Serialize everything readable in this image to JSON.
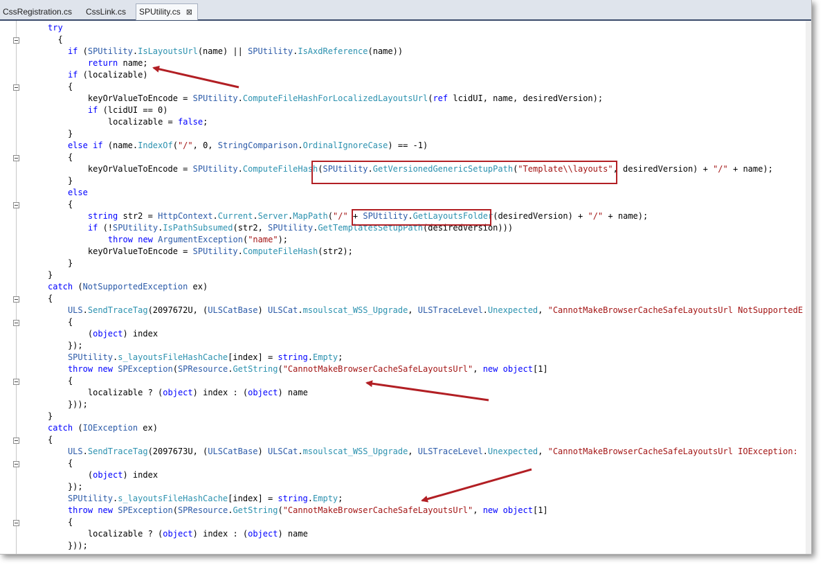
{
  "tabs": [
    {
      "label": "CssRegistration.cs",
      "active": false
    },
    {
      "label": "CssLink.cs",
      "active": false
    },
    {
      "label": "SPUtility.cs",
      "active": true,
      "close": "⊠"
    }
  ],
  "code_lines": [
    [
      {
        "t": "try",
        "c": "kw"
      }
    ],
    [
      {
        "t": "{"
      }
    ],
    [
      {
        "t": "  "
      },
      {
        "t": "if",
        "c": "kw"
      },
      {
        "t": " ("
      },
      {
        "t": "SPUtility",
        "c": "ty"
      },
      {
        "t": "."
      },
      {
        "t": "IsLayoutsUrl",
        "c": "mt"
      },
      {
        "t": "(name) || "
      },
      {
        "t": "SPUtility",
        "c": "ty"
      },
      {
        "t": "."
      },
      {
        "t": "IsAxdReference",
        "c": "mt"
      },
      {
        "t": "(name))"
      }
    ],
    [
      {
        "t": "    "
      },
      {
        "t": "return",
        "c": "kw"
      },
      {
        "t": " name;"
      }
    ],
    [
      {
        "t": "  "
      },
      {
        "t": "if",
        "c": "kw"
      },
      {
        "t": " (localizable)"
      }
    ],
    [
      {
        "t": "  {"
      }
    ],
    [
      {
        "t": "    keyOrValueToEncode = "
      },
      {
        "t": "SPUtility",
        "c": "ty"
      },
      {
        "t": "."
      },
      {
        "t": "ComputeFileHashForLocalizedLayoutsUrl",
        "c": "mt"
      },
      {
        "t": "("
      },
      {
        "t": "ref",
        "c": "kw"
      },
      {
        "t": " lcidUI, name, desiredVersion);"
      }
    ],
    [
      {
        "t": "    "
      },
      {
        "t": "if",
        "c": "kw"
      },
      {
        "t": " (lcidUI == 0)"
      }
    ],
    [
      {
        "t": "      localizable = "
      },
      {
        "t": "false",
        "c": "kw"
      },
      {
        "t": ";"
      }
    ],
    [
      {
        "t": "  }"
      }
    ],
    [
      {
        "t": "  "
      },
      {
        "t": "else",
        "c": "kw"
      },
      {
        "t": " "
      },
      {
        "t": "if",
        "c": "kw"
      },
      {
        "t": " (name."
      },
      {
        "t": "IndexOf",
        "c": "mt"
      },
      {
        "t": "("
      },
      {
        "t": "\"/\"",
        "c": "st"
      },
      {
        "t": ", 0, "
      },
      {
        "t": "StringComparison",
        "c": "ty"
      },
      {
        "t": "."
      },
      {
        "t": "OrdinalIgnoreCase",
        "c": "mt"
      },
      {
        "t": ") == -1)"
      }
    ],
    [
      {
        "t": "  {"
      }
    ],
    [
      {
        "t": "    keyOrValueToEncode = "
      },
      {
        "t": "SPUtility",
        "c": "ty"
      },
      {
        "t": "."
      },
      {
        "t": "ComputeFileHash",
        "c": "mt"
      },
      {
        "t": "("
      },
      {
        "t": "SPUtility",
        "c": "ty"
      },
      {
        "t": "."
      },
      {
        "t": "GetVersionedGenericSetupPath",
        "c": "mt"
      },
      {
        "t": "("
      },
      {
        "t": "\"Template\\\\layouts\"",
        "c": "st"
      },
      {
        "t": ", desiredVersion) + "
      },
      {
        "t": "\"/\"",
        "c": "st"
      },
      {
        "t": " + name);"
      }
    ],
    [
      {
        "t": "  }"
      }
    ],
    [
      {
        "t": "  "
      },
      {
        "t": "else",
        "c": "kw"
      }
    ],
    [
      {
        "t": "  {"
      }
    ],
    [
      {
        "t": "    "
      },
      {
        "t": "string",
        "c": "kw"
      },
      {
        "t": " str2 = "
      },
      {
        "t": "HttpContext",
        "c": "ty"
      },
      {
        "t": "."
      },
      {
        "t": "Current",
        "c": "mt"
      },
      {
        "t": "."
      },
      {
        "t": "Server",
        "c": "mt"
      },
      {
        "t": "."
      },
      {
        "t": "MapPath",
        "c": "mt"
      },
      {
        "t": "("
      },
      {
        "t": "\"/\"",
        "c": "st"
      },
      {
        "t": " + "
      },
      {
        "t": "SPUtility",
        "c": "ty"
      },
      {
        "t": "."
      },
      {
        "t": "GetLayoutsFolder",
        "c": "mt"
      },
      {
        "t": "(desiredVersion) + "
      },
      {
        "t": "\"/\"",
        "c": "st"
      },
      {
        "t": " + name);"
      }
    ],
    [
      {
        "t": "    "
      },
      {
        "t": "if",
        "c": "kw"
      },
      {
        "t": " (!"
      },
      {
        "t": "SPUtility",
        "c": "ty"
      },
      {
        "t": "."
      },
      {
        "t": "IsPathSubsumed",
        "c": "mt"
      },
      {
        "t": "(str2, "
      },
      {
        "t": "SPUtility",
        "c": "ty"
      },
      {
        "t": "."
      },
      {
        "t": "GetTemplatesSetupPath",
        "c": "mt"
      },
      {
        "t": "(desiredVersion)))"
      }
    ],
    [
      {
        "t": "      "
      },
      {
        "t": "throw",
        "c": "kw"
      },
      {
        "t": " "
      },
      {
        "t": "new",
        "c": "kw"
      },
      {
        "t": " "
      },
      {
        "t": "ArgumentException",
        "c": "ty"
      },
      {
        "t": "("
      },
      {
        "t": "\"name\"",
        "c": "st"
      },
      {
        "t": ");"
      }
    ],
    [
      {
        "t": "    keyOrValueToEncode = "
      },
      {
        "t": "SPUtility",
        "c": "ty"
      },
      {
        "t": "."
      },
      {
        "t": "ComputeFileHash",
        "c": "mt"
      },
      {
        "t": "(str2);"
      }
    ],
    [
      {
        "t": "  }"
      }
    ],
    [
      {
        "t": "}"
      }
    ],
    [
      {
        "t": "catch",
        "c": "kw"
      },
      {
        "t": " ("
      },
      {
        "t": "NotSupportedException",
        "c": "ty"
      },
      {
        "t": " ex)"
      }
    ],
    [
      {
        "t": "{"
      }
    ],
    [
      {
        "t": "  "
      },
      {
        "t": "ULS",
        "c": "ty"
      },
      {
        "t": "."
      },
      {
        "t": "SendTraceTag",
        "c": "mt"
      },
      {
        "t": "(2097672U, ("
      },
      {
        "t": "ULSCatBase",
        "c": "ty"
      },
      {
        "t": ") "
      },
      {
        "t": "ULSCat",
        "c": "ty"
      },
      {
        "t": "."
      },
      {
        "t": "msoulscat_WSS_Upgrade",
        "c": "mt"
      },
      {
        "t": ", "
      },
      {
        "t": "ULSTraceLevel",
        "c": "ty"
      },
      {
        "t": "."
      },
      {
        "t": "Unexpected",
        "c": "mt"
      },
      {
        "t": ", "
      },
      {
        "t": "\"CannotMakeBrowserCacheSafeLayoutsUrl NotSupportedE",
        "c": "st"
      }
    ],
    [
      {
        "t": "  {"
      }
    ],
    [
      {
        "t": "    ("
      },
      {
        "t": "object",
        "c": "kw"
      },
      {
        "t": ") index"
      }
    ],
    [
      {
        "t": "  });"
      }
    ],
    [
      {
        "t": "  "
      },
      {
        "t": "SPUtility",
        "c": "ty"
      },
      {
        "t": "."
      },
      {
        "t": "s_layoutsFileHashCache",
        "c": "mt"
      },
      {
        "t": "[index] = "
      },
      {
        "t": "string",
        "c": "kw"
      },
      {
        "t": "."
      },
      {
        "t": "Empty",
        "c": "mt"
      },
      {
        "t": ";"
      }
    ],
    [
      {
        "t": "  "
      },
      {
        "t": "throw",
        "c": "kw"
      },
      {
        "t": " "
      },
      {
        "t": "new",
        "c": "kw"
      },
      {
        "t": " "
      },
      {
        "t": "SPException",
        "c": "ty"
      },
      {
        "t": "("
      },
      {
        "t": "SPResource",
        "c": "ty"
      },
      {
        "t": "."
      },
      {
        "t": "GetString",
        "c": "mt"
      },
      {
        "t": "("
      },
      {
        "t": "\"CannotMakeBrowserCacheSafeLayoutsUrl\"",
        "c": "st"
      },
      {
        "t": ", "
      },
      {
        "t": "new",
        "c": "kw"
      },
      {
        "t": " "
      },
      {
        "t": "object",
        "c": "kw"
      },
      {
        "t": "[1]"
      }
    ],
    [
      {
        "t": "  {"
      }
    ],
    [
      {
        "t": "    localizable ? ("
      },
      {
        "t": "object",
        "c": "kw"
      },
      {
        "t": ") index : ("
      },
      {
        "t": "object",
        "c": "kw"
      },
      {
        "t": ") name"
      }
    ],
    [
      {
        "t": "  }));"
      }
    ],
    [
      {
        "t": "}"
      }
    ],
    [
      {
        "t": "catch",
        "c": "kw"
      },
      {
        "t": " ("
      },
      {
        "t": "IOException",
        "c": "ty"
      },
      {
        "t": " ex)"
      }
    ],
    [
      {
        "t": "{"
      }
    ],
    [
      {
        "t": "  "
      },
      {
        "t": "ULS",
        "c": "ty"
      },
      {
        "t": "."
      },
      {
        "t": "SendTraceTag",
        "c": "mt"
      },
      {
        "t": "(2097673U, ("
      },
      {
        "t": "ULSCatBase",
        "c": "ty"
      },
      {
        "t": ") "
      },
      {
        "t": "ULSCat",
        "c": "ty"
      },
      {
        "t": "."
      },
      {
        "t": "msoulscat_WSS_Upgrade",
        "c": "mt"
      },
      {
        "t": ", "
      },
      {
        "t": "ULSTraceLevel",
        "c": "ty"
      },
      {
        "t": "."
      },
      {
        "t": "Unexpected",
        "c": "mt"
      },
      {
        "t": ", "
      },
      {
        "t": "\"CannotMakeBrowserCacheSafeLayoutsUrl IOException:",
        "c": "st"
      }
    ],
    [
      {
        "t": "  {"
      }
    ],
    [
      {
        "t": "    ("
      },
      {
        "t": "object",
        "c": "kw"
      },
      {
        "t": ") index"
      }
    ],
    [
      {
        "t": "  });"
      }
    ],
    [
      {
        "t": "  "
      },
      {
        "t": "SPUtility",
        "c": "ty"
      },
      {
        "t": "."
      },
      {
        "t": "s_layoutsFileHashCache",
        "c": "mt"
      },
      {
        "t": "[index] = "
      },
      {
        "t": "string",
        "c": "kw"
      },
      {
        "t": "."
      },
      {
        "t": "Empty",
        "c": "mt"
      },
      {
        "t": ";"
      }
    ],
    [
      {
        "t": "  "
      },
      {
        "t": "throw",
        "c": "kw"
      },
      {
        "t": " "
      },
      {
        "t": "new",
        "c": "kw"
      },
      {
        "t": " "
      },
      {
        "t": "SPException",
        "c": "ty"
      },
      {
        "t": "("
      },
      {
        "t": "SPResource",
        "c": "ty"
      },
      {
        "t": "."
      },
      {
        "t": "GetString",
        "c": "mt"
      },
      {
        "t": "("
      },
      {
        "t": "\"CannotMakeBrowserCacheSafeLayoutsUrl\"",
        "c": "st"
      },
      {
        "t": ", "
      },
      {
        "t": "new",
        "c": "kw"
      },
      {
        "t": " "
      },
      {
        "t": "object",
        "c": "kw"
      },
      {
        "t": "[1]"
      }
    ],
    [
      {
        "t": "  {"
      }
    ],
    [
      {
        "t": "    localizable ? ("
      },
      {
        "t": "object",
        "c": "kw"
      },
      {
        "t": ") index : ("
      },
      {
        "t": "object",
        "c": "kw"
      },
      {
        "t": ") name"
      }
    ],
    [
      {
        "t": "  }));"
      }
    ]
  ],
  "colors": {
    "keyword": "#0000ff",
    "type": "#2b5aa8",
    "member": "#2b91af",
    "string": "#a31515",
    "annotation": "#b21f24"
  }
}
